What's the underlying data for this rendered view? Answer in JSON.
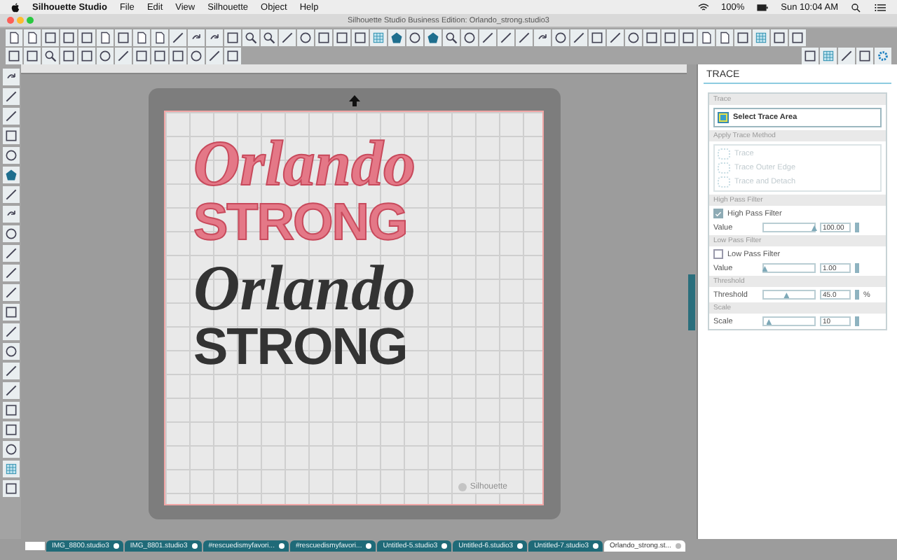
{
  "menu_bar": {
    "app_name": "Silhouette Studio",
    "items": [
      "File",
      "Edit",
      "View",
      "Silhouette",
      "Object",
      "Help"
    ],
    "battery": "100%",
    "clock": "Sun 10:04 AM"
  },
  "window": {
    "title": "Silhouette Studio Business Edition: Orlando_strong.studio3"
  },
  "canvas": {
    "designs": [
      {
        "kind": "outline",
        "lines": [
          "Orlando",
          "STRONG"
        ]
      },
      {
        "kind": "filled",
        "lines": [
          "Orlando",
          "STRONG"
        ]
      }
    ],
    "mat_logo": "Silhouette"
  },
  "panel": {
    "title": "TRACE",
    "sections": [
      {
        "heading": "Trace",
        "kind": "button",
        "label": "Select Trace Area"
      },
      {
        "heading": "Apply Trace Method",
        "kind": "methods",
        "items": [
          {
            "label": "Trace",
            "disabled": true
          },
          {
            "label": "Trace Outer Edge",
            "disabled": true
          },
          {
            "label": "Trace and Detach",
            "disabled": true
          }
        ]
      },
      {
        "heading": "High Pass Filter",
        "kind": "filter",
        "check_label": "High Pass Filter",
        "checked": true,
        "slider_label": "Value",
        "level": 1.0,
        "reading": "100.00"
      },
      {
        "heading": "Low Pass Filter",
        "kind": "filter",
        "check_label": "Low Pass Filter",
        "checked": false,
        "slider_label": "Value",
        "level": 0.02,
        "reading": "1.00"
      },
      {
        "heading": "Threshold",
        "kind": "slider",
        "slider_label": "Threshold",
        "level": 0.45,
        "reading": "45.0",
        "unit": "%"
      },
      {
        "heading": "Scale",
        "kind": "slider",
        "slider_label": "Scale",
        "level": 0.1,
        "reading": "10"
      }
    ]
  },
  "tabs": [
    {
      "label": "IMG_8800.studio3",
      "selected": false
    },
    {
      "label": "IMG_8801.studio3",
      "selected": false
    },
    {
      "label": "#rescuedismyfavori...",
      "selected": false
    },
    {
      "label": "#rescuedismyfavori...",
      "selected": false
    },
    {
      "label": "Untitled-5.studio3",
      "selected": false
    },
    {
      "label": "Untitled-6.studio3",
      "selected": false
    },
    {
      "label": "Untitled-7.studio3",
      "selected": false
    },
    {
      "label": "Orlando_strong.st...",
      "selected": true
    }
  ]
}
